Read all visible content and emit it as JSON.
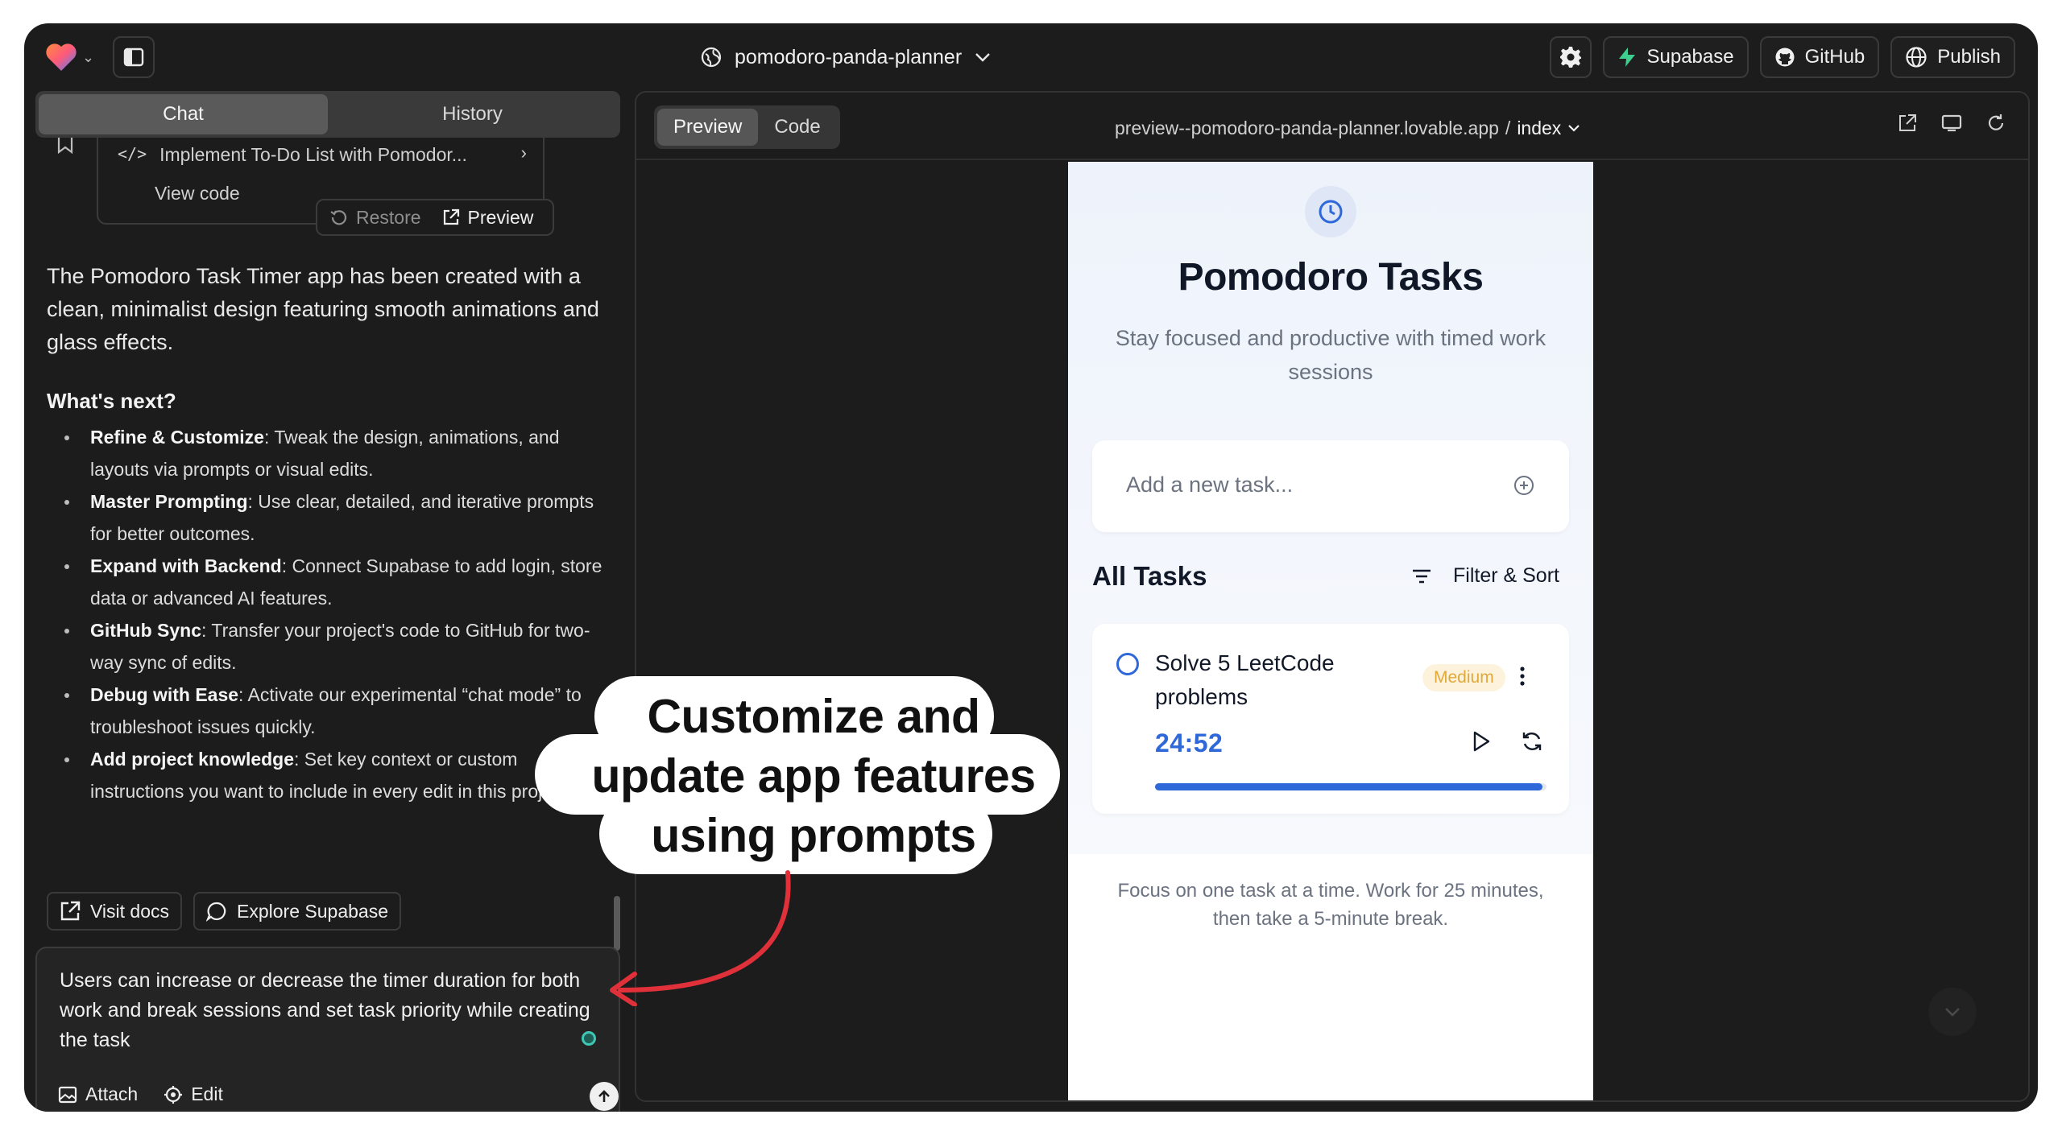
{
  "topbar": {
    "project_name": "pomodoro-panda-planner",
    "supabase_label": "Supabase",
    "github_label": "GitHub",
    "publish_label": "Publish"
  },
  "chat": {
    "tabs": [
      "Chat",
      "History"
    ],
    "commit_title": "Implement To-Do List with Pomodor...",
    "view_code_label": "View code",
    "restore_label": "Restore",
    "preview_label": "Preview",
    "message": "The Pomodoro Task Timer app has been created with a clean, minimalist design featuring smooth animations and glass effects.",
    "next_heading": "What's next?",
    "next_items": [
      {
        "title": "Refine & Customize",
        "text": ": Tweak the design, animations, and layouts via prompts or visual edits."
      },
      {
        "title": "Master Prompting",
        "text": ": Use clear, detailed, and iterative prompts for better outcomes."
      },
      {
        "title": "Expand with Backend",
        "text": ": Connect Supabase to add login, store data or advanced AI features."
      },
      {
        "title": "GitHub Sync",
        "text": ": Transfer your project's code to GitHub for two-way sync of edits."
      },
      {
        "title": "Debug with Ease",
        "text": ": Activate our experimental “chat mode” to troubleshoot issues quickly."
      },
      {
        "title": "Add project knowledge",
        "text": ": Set key context or custom instructions you want to include in every edit in this project."
      }
    ],
    "visit_docs_label": "Visit docs",
    "explore_supabase_label": "Explore Supabase",
    "prompt_value": "Users can increase or decrease the timer duration for both work and break sessions and set task priority while creating the task",
    "attach_label": "Attach",
    "edit_label": "Edit"
  },
  "preview": {
    "toggle": [
      "Preview",
      "Code"
    ],
    "url": "preview--pomodoro-panda-planner.lovable.app",
    "url_sep": "/",
    "route": "index"
  },
  "app": {
    "title": "Pomodoro Tasks",
    "subtitle": "Stay focused and productive with timed work sessions",
    "add_placeholder": "Add a new task...",
    "all_tasks_label": "All Tasks",
    "filter_label": "Filter & Sort",
    "task": {
      "name": "Solve 5 LeetCode problems",
      "priority": "Medium",
      "timer": "24:52",
      "progress": 0.99
    },
    "focus_note": "Focus on one task at a time. Work for 25 minutes, then take a 5-minute break."
  },
  "callout": {
    "lines": [
      "Customize and",
      "update app features",
      "using prompts"
    ]
  },
  "colors": {
    "accent_blue": "#2f68d8",
    "supabase_green": "#3ecf8e",
    "callout_arrow": "#e0303a",
    "priority_medium": "#e0a93a"
  }
}
